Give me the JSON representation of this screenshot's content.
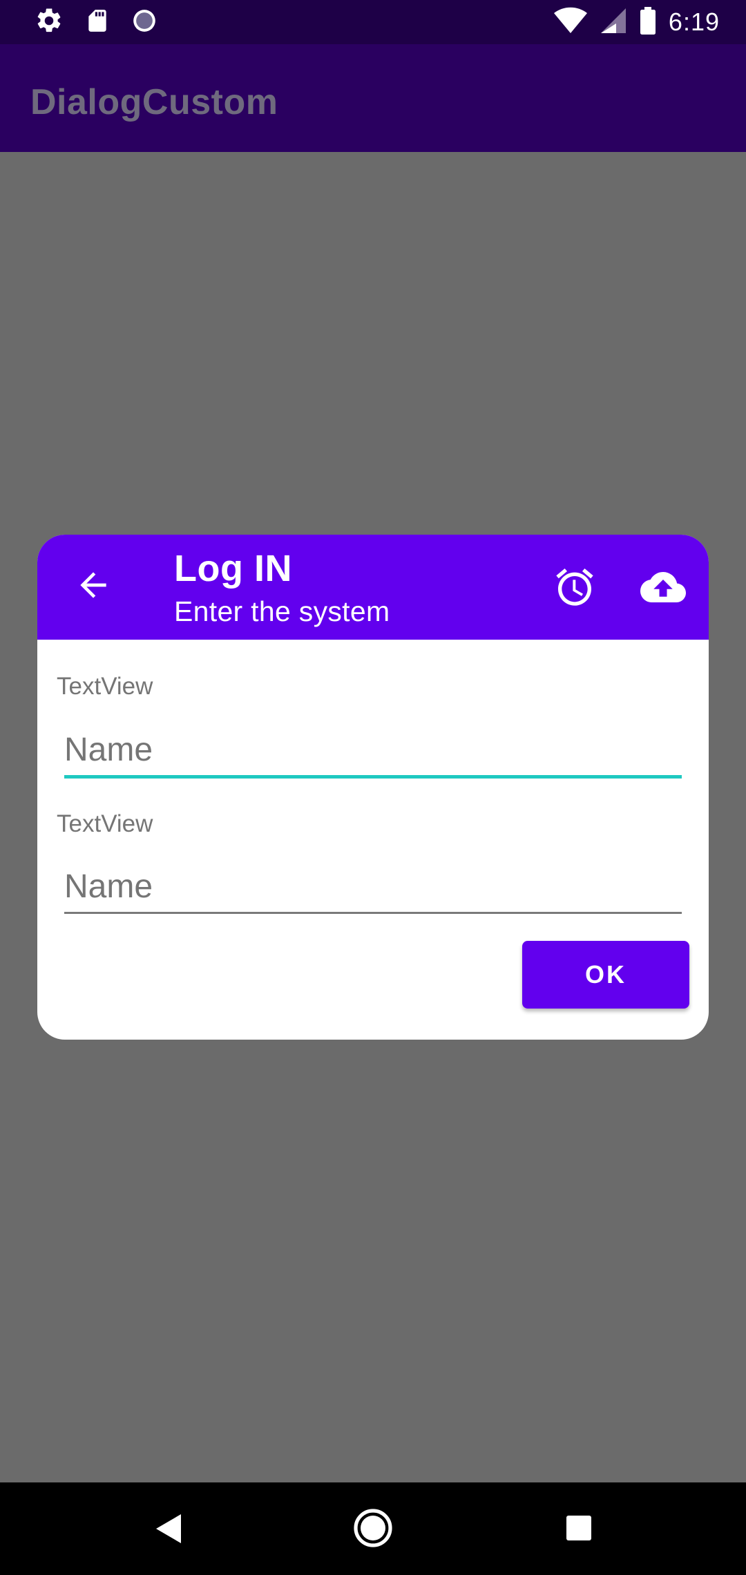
{
  "status_bar": {
    "time": "6:19",
    "left_icons": [
      "gear-icon",
      "sd-card-icon",
      "sync-progress-icon"
    ],
    "right_icons": [
      "wifi-icon",
      "cell-signal-icon",
      "battery-icon"
    ]
  },
  "app_bar": {
    "title": "DialogCustom"
  },
  "dialog": {
    "header": {
      "title": "Log IN",
      "subtitle": "Enter the system",
      "back_icon": "arrow-back-icon",
      "action_icons": [
        "alarm-icon",
        "cloud-upload-icon"
      ],
      "background": "#6200ee"
    },
    "fields": [
      {
        "label": "TextView",
        "placeholder": "Name",
        "value": "",
        "focused": true,
        "underline_color": "#1fc9c1"
      },
      {
        "label": "TextView",
        "placeholder": "Name",
        "value": "",
        "focused": false,
        "underline_color": "#7a7a7a"
      }
    ],
    "ok_button": {
      "label": "OK",
      "background": "#6200ee"
    }
  },
  "nav_bar": {
    "icons": [
      "nav-back-icon",
      "nav-home-icon",
      "nav-recents-icon"
    ]
  },
  "colors": {
    "accent": "#6200ee",
    "status_bar": "#1e0047",
    "scrim_background": "#6b6b6b"
  }
}
